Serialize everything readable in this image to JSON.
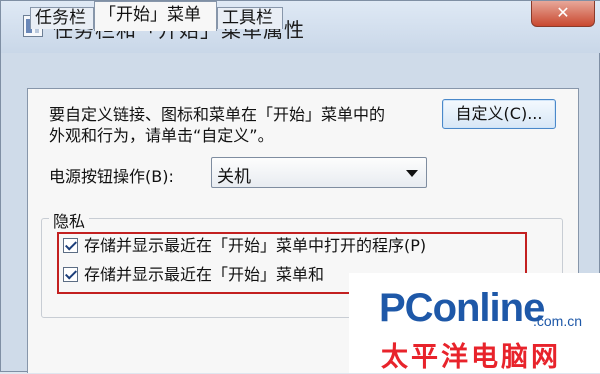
{
  "window": {
    "title": "任务栏和「开始」菜单属性",
    "close_label": "✕"
  },
  "tabs": [
    {
      "label": "任务栏"
    },
    {
      "label": "「开始」菜单"
    },
    {
      "label": "工具栏"
    }
  ],
  "description": {
    "line1": "要自定义链接、图标和菜单在「开始」菜单中的",
    "line2": "外观和行为，请单击“自定义”。"
  },
  "customize_button": "自定义(C)...",
  "power": {
    "label": "电源按钮操作(B):",
    "value": "关机"
  },
  "privacy": {
    "group_label": "隐私",
    "options": [
      {
        "label": "存储并显示最近在「开始」菜单中打开的程序(P)",
        "checked": true
      },
      {
        "label": "存储并显示最近在「开始」菜单和",
        "checked": true
      }
    ]
  },
  "watermark": {
    "logo": "PConline",
    "domain": ".com.cn",
    "cn": "太平洋电脑网"
  }
}
